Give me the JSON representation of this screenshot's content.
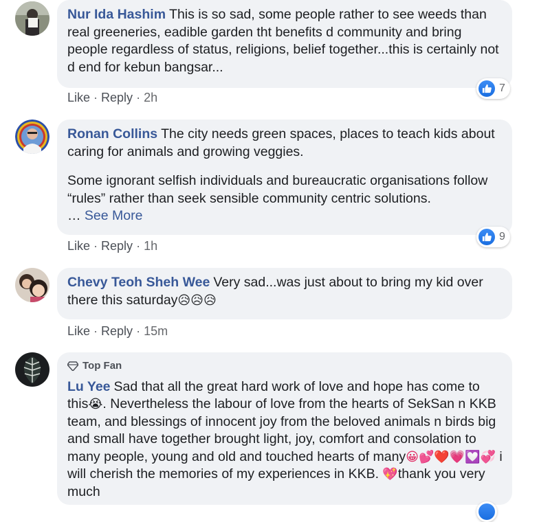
{
  "comments": [
    {
      "author": "Nur Ida Hashim",
      "text": "This is so sad, some people rather to see weeds than real greeneries, eadible garden tht benefits d community and bring people regardless of status, religions, belief together...this is certainly not d end for kebun bangsar...",
      "like": "Like",
      "reply": "Reply",
      "time": "2h",
      "reactions": "7",
      "avatar_icon": "person-avatar"
    },
    {
      "author": "Ronan Collins",
      "text": "The city needs green spaces, places to teach kids about caring for animals and growing veggies.",
      "text2": "Some ignorant selfish individuals and bureaucratic organisations follow “rules” rather than seek sensible community centric solutions.",
      "ellipsis": "…",
      "see_more": "See More",
      "like": "Like",
      "reply": "Reply",
      "time": "1h",
      "reactions": "9",
      "avatar_icon": "person-avatar"
    },
    {
      "author": "Chevy Teoh Sheh Wee",
      "text": "Very sad...was just about to bring my kid over there this saturday",
      "emojis": "😥😥😥",
      "like": "Like",
      "reply": "Reply",
      "time": "15m",
      "avatar_icon": "person-avatar"
    },
    {
      "badge": "Top Fan",
      "author": "Lu Yee",
      "text_a": "Sad that all the great hard work of love and hope has come to this",
      "emoji_a": "😭",
      "text_b": ". Nevertheless the labour of love from the hearts of SekSan n KKB team, and blessings of innocent joy from the beloved animals n birds big and small have together brought light, joy, comfort and consolation to many people, young and old and touched hearts of many",
      "emoji_b": "😀💕❤️💗💟💞",
      "text_c": " i will cherish the memories of my experiences in KKB. ",
      "emoji_c": "💖",
      "text_d": "thank you very much",
      "avatar_icon": "leaf-avatar"
    }
  ],
  "separator": " · ",
  "colors": {
    "author": "#385898",
    "bubble": "#f0f2f5",
    "like": "#1877f2"
  }
}
